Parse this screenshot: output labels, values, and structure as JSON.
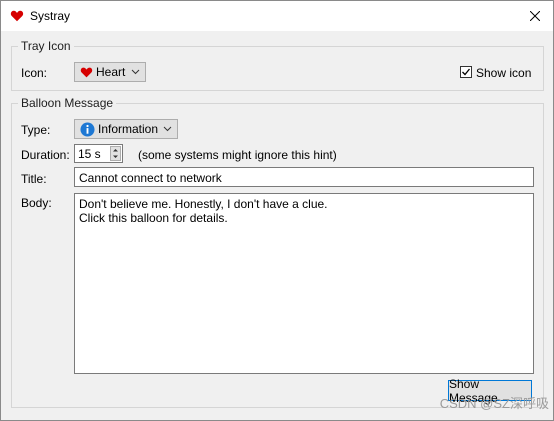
{
  "window": {
    "title": "Systray"
  },
  "tray_icon": {
    "group_title": "Tray Icon",
    "icon_label": "Icon:",
    "icon_value": "Heart",
    "show_icon_label": "Show icon",
    "show_icon_checked": true
  },
  "balloon": {
    "group_title": "Balloon Message",
    "type_label": "Type:",
    "type_value": "Information",
    "duration_label": "Duration:",
    "duration_value": "15 s",
    "duration_hint": "(some systems might ignore this hint)",
    "title_label": "Title:",
    "title_value": "Cannot connect to network",
    "body_label": "Body:",
    "body_value": "Don't believe me. Honestly, I don't have a clue.\nClick this balloon for details.",
    "show_button": "Show Message"
  },
  "watermark": "CSDN @SZ深呼吸",
  "colors": {
    "heart": "#d60000",
    "info": "#1e78d4",
    "focus_border": "#0078d7"
  }
}
